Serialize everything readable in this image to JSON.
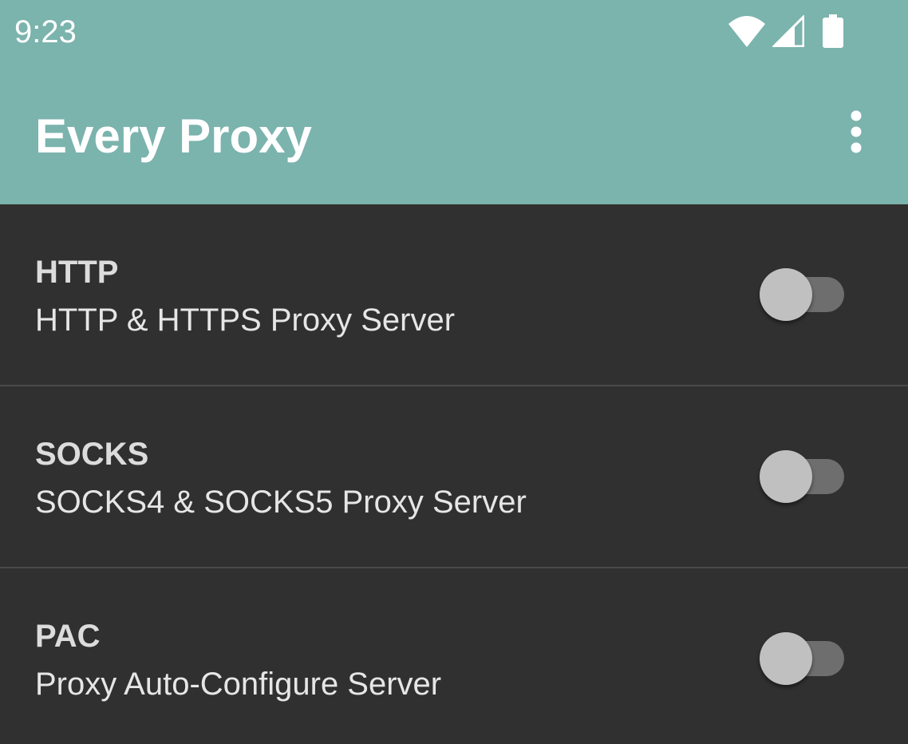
{
  "status_bar": {
    "time": "9:23",
    "icons": [
      "wifi-icon",
      "cell-signal-icon",
      "battery-icon"
    ]
  },
  "toolbar": {
    "title": "Every Proxy",
    "menu_icon": "more-vert-icon"
  },
  "colors": {
    "header": "#7bb3ad",
    "background": "#303030",
    "divider": "#4a4a4a",
    "switch_thumb": "#c0c0c0",
    "switch_track": "#6e6e6e"
  },
  "items": [
    {
      "title": "HTTP",
      "subtitle": "HTTP & HTTPS Proxy Server",
      "enabled": false
    },
    {
      "title": "SOCKS",
      "subtitle": "SOCKS4 & SOCKS5 Proxy Server",
      "enabled": false
    },
    {
      "title": "PAC",
      "subtitle": "Proxy Auto-Configure Server",
      "enabled": false
    }
  ]
}
